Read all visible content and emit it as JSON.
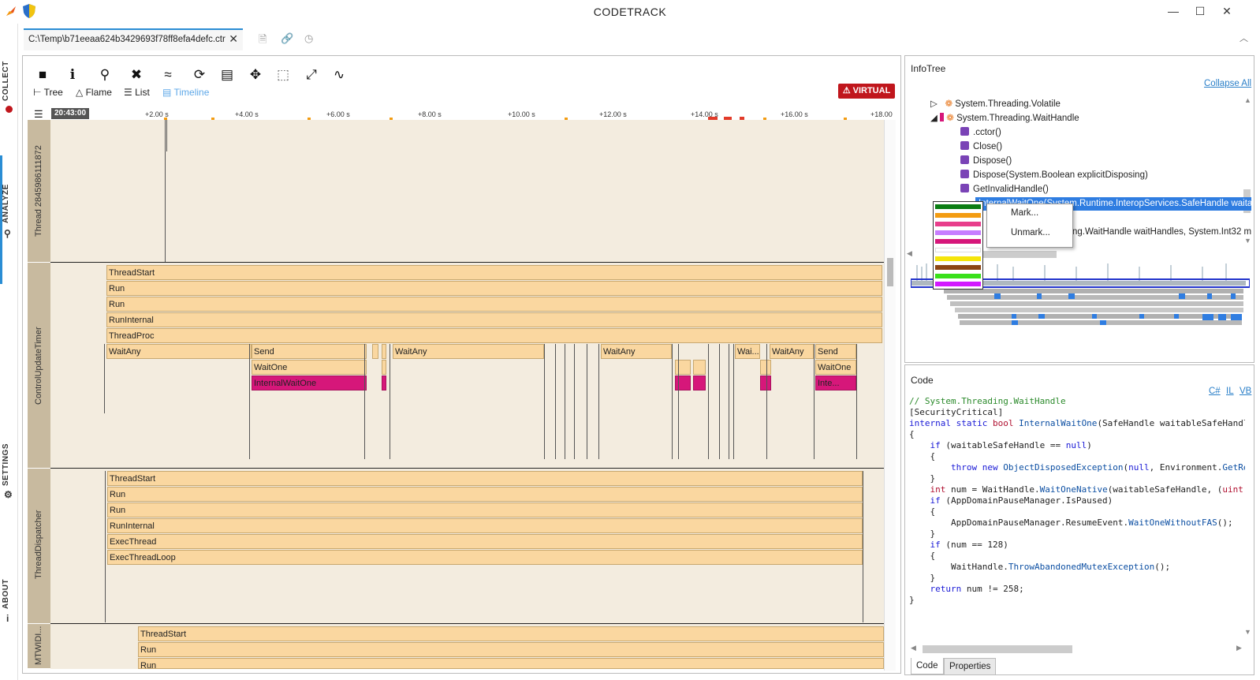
{
  "app": {
    "title": "CODETRACK"
  },
  "window_controls": {
    "minimize": "—",
    "maximize": "☐",
    "close": "✕"
  },
  "nav": {
    "items": [
      {
        "label": "COLLECT",
        "icon": "record-icon"
      },
      {
        "label": "ANALYZE",
        "icon": "search-icon"
      },
      {
        "label": "SETTINGS",
        "icon": "settings-icon"
      },
      {
        "label": "ABOUT",
        "icon": "info-icon"
      }
    ]
  },
  "file_tab": {
    "label": "C:\\Temp\\b71eeaa624b3429693f78ff8efa4defc.ctr",
    "close": "✕"
  },
  "view_tabs": {
    "tree": "Tree",
    "flame": "Flame",
    "list": "List",
    "timeline": "Timeline"
  },
  "badge": "VIRTUAL",
  "ruler": {
    "start": "20:43:00",
    "ticks": [
      "+2.00 s",
      "+4.00 s",
      "+6.00 s",
      "+8.00 s",
      "+10.00 s",
      "+12.00 s",
      "+14.00 s",
      "+16.00 s",
      "+18.00"
    ]
  },
  "threads": [
    {
      "name": "Thread 2845986111872"
    },
    {
      "name": "ControlUpdateTimer",
      "frames": [
        "ThreadStart",
        "Run",
        "Run",
        "RunInternal",
        "ThreadProc"
      ],
      "level6": [
        "WaitAny",
        "Send",
        "WaitAny",
        "WaitAny",
        "Wai...",
        "WaitAny",
        "Send"
      ],
      "level7": [
        "WaitOne",
        "WaitOne"
      ],
      "level8": [
        "InternalWaitOne",
        "Inte..."
      ]
    },
    {
      "name": "ThreadDispatcher",
      "frames": [
        "ThreadStart",
        "Run",
        "Run",
        "RunInternal",
        "ExecThread",
        "ExecThreadLoop"
      ]
    },
    {
      "name": "MTWIDI...",
      "frames": [
        "ThreadStart",
        "Run",
        "Run"
      ]
    }
  ],
  "infotree": {
    "title": "InfoTree",
    "collapse": "Collapse All",
    "rows": [
      "System.Threading.Volatile",
      "System.Threading.WaitHandle",
      ".cctor()",
      "Close()",
      "Dispose()",
      "Dispose(System.Boolean explicitDisposing)",
      "GetInvalidHandle()"
    ],
    "selected": "InternalWaitOne(System.Runtime.InteropServices.SafeHandle waita",
    "partial": "ng.WaitHandle waitHandles, System.Int32 m",
    "context_menu": [
      "Mark...",
      "Unmark..."
    ],
    "mark_colors": [
      "#0b7d13",
      "#f39c12",
      "#e83e8c",
      "#c77dff",
      "#d6177a",
      "#ffffff",
      "#f5e50a",
      "#8b4513",
      "#39e01b",
      "#d21aff"
    ]
  },
  "code": {
    "title": "Code",
    "langs": [
      "C#",
      "IL",
      "VB"
    ],
    "tabs": [
      "Code",
      "Properties"
    ]
  }
}
